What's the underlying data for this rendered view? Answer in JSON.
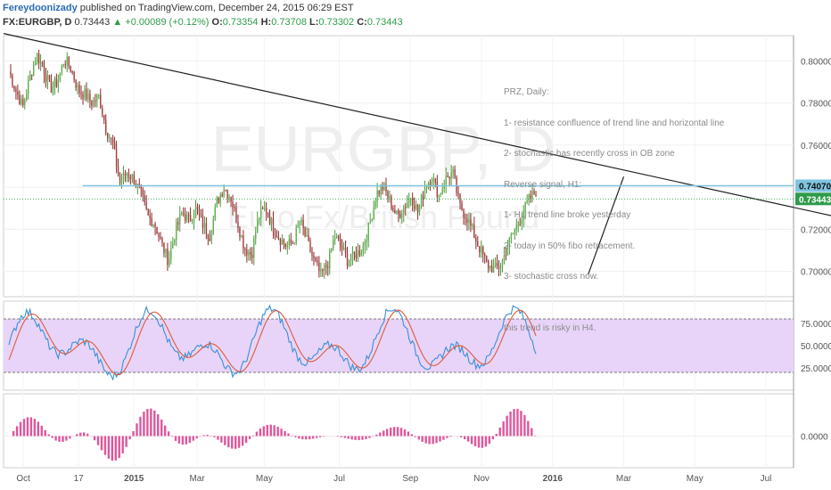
{
  "header": {
    "author": "Fereydoonizady",
    "published": " published on TradingView.com, December 24, 2015 06:29 EST"
  },
  "ohlc": {
    "symbol": "FX:EURGBP, D",
    "last": "0.73443",
    "change": "+0.00089 (+0.12%)",
    "o_label": "O:",
    "o": "0.73354",
    "h_label": "H:",
    "h": "0.73708",
    "l_label": "L:",
    "l": "0.73302",
    "c_label": "C:",
    "c": "0.73443"
  },
  "watermark": {
    "symbol": "EURGBP, D",
    "name": "Euro Fx/British Pound"
  },
  "note_lines": [
    "PRZ, Daily:",
    "1- resistance confluence of trend line and horizontal line",
    "2- stochastic has recently cross in OB zone",
    "Reverse signal, H1:",
    "1- H1 trend line broke yesterday",
    "2- today in 50% fibo retracement.",
    "3- stochastic cross now.",
    "",
    "this trend is risky in H4."
  ],
  "colors": {
    "up": "#4a9a3a",
    "down": "#8b2a2a",
    "candle_body_up": "#5fae4c",
    "candle_body_down": "#a33a3a",
    "trend": "#222222",
    "horizontal": "#7fc4e0",
    "stoch_k": "#3a8fd6",
    "stoch_d": "#e05a3a",
    "stoch_band": "#e8d4f8",
    "histogram": "#e0559a",
    "last_price": "#2e9b4a"
  },
  "chart_data": [
    {
      "type": "candlestick",
      "title": "EURGBP, D",
      "ylim": [
        0.688,
        0.812
      ],
      "y_ticks": [
        "0.80000",
        "0.78000",
        "0.76000",
        "0.74000",
        "0.72000",
        "0.70000"
      ],
      "x_ticks": [
        "Oct",
        "17",
        "2015",
        "Mar",
        "May",
        "Jul",
        "Sep",
        "Nov",
        "2016",
        "Mar",
        "May",
        "Jul"
      ],
      "price_labels": [
        {
          "label": "0.74070",
          "value": 0.7407,
          "style": "horizontal"
        },
        {
          "label": "0.73443",
          "value": 0.73443,
          "style": "last"
        }
      ],
      "close_path": [
        0.795,
        0.786,
        0.778,
        0.792,
        0.803,
        0.796,
        0.787,
        0.79,
        0.801,
        0.796,
        0.786,
        0.784,
        0.78,
        0.783,
        0.768,
        0.76,
        0.742,
        0.747,
        0.744,
        0.737,
        0.726,
        0.723,
        0.713,
        0.705,
        0.719,
        0.728,
        0.724,
        0.73,
        0.722,
        0.717,
        0.733,
        0.74,
        0.735,
        0.723,
        0.711,
        0.708,
        0.726,
        0.73,
        0.722,
        0.716,
        0.712,
        0.714,
        0.724,
        0.714,
        0.705,
        0.698,
        0.704,
        0.717,
        0.711,
        0.704,
        0.708,
        0.711,
        0.722,
        0.737,
        0.74,
        0.733,
        0.726,
        0.731,
        0.736,
        0.728,
        0.74,
        0.745,
        0.736,
        0.744,
        0.747,
        0.731,
        0.726,
        0.718,
        0.71,
        0.703,
        0.701,
        0.703,
        0.713,
        0.72,
        0.727,
        0.734,
        0.738
      ],
      "trendlines": [
        {
          "name": "Downtrend",
          "from": {
            "t": 0,
            "price": 0.813
          },
          "to": {
            "t": 1.12,
            "price": 0.7205
          }
        },
        {
          "name": "Uptrend",
          "from": {
            "t": 0.74,
            "price": 0.6985
          },
          "to": {
            "t": 0.785,
            "price": 0.745
          }
        },
        {
          "name": "Horizontal",
          "from": {
            "t": 0.1,
            "price": 0.7407
          },
          "to": {
            "t": 1.0,
            "price": 0.7407
          }
        }
      ]
    },
    {
      "type": "line",
      "title": "Stochastic",
      "ylim": [
        0,
        100
      ],
      "y_ticks": [
        "75.0000",
        "50.0000",
        "25.0000"
      ],
      "bands": [
        80,
        20
      ]
    },
    {
      "type": "bar",
      "title": "Histogram",
      "y_ticks": [
        "0.0000"
      ]
    }
  ]
}
